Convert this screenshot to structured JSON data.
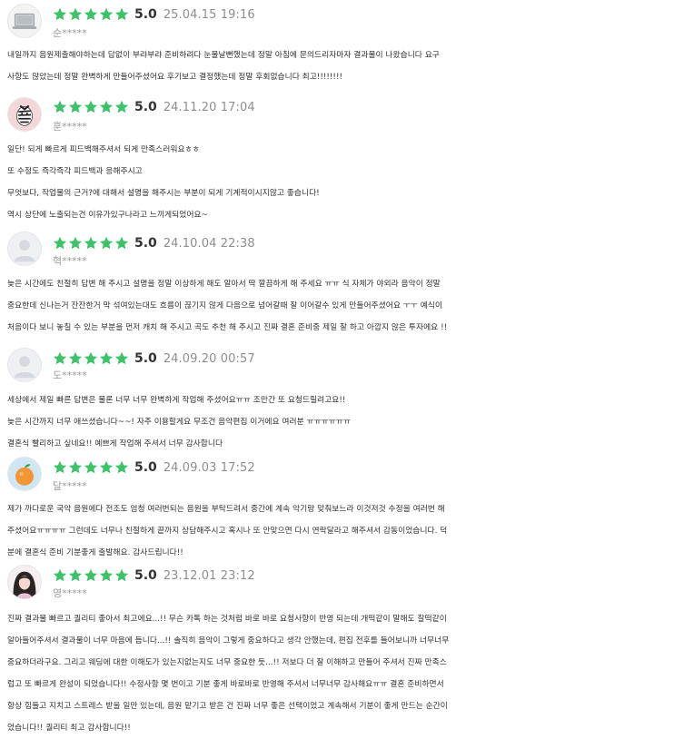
{
  "colors": {
    "star": "#3dc26a",
    "text": "#303030",
    "muted": "#8e8e8e"
  },
  "reviews": [
    {
      "avatar": "laptop-avatar",
      "score": "5.0",
      "date": "25.04.15 19:16",
      "user": "순*****",
      "lines": [
        "내일까지 음원제출해야하는데 답없이 부랴부랴 준비하려다 눈물날뻔했는데 정말 아침에 문의드리자마자 결과물이 나왔습니다 요구",
        "사항도 많았는데 정말  완벽하게 만들어주셨어요 후기보고 결정했는데 정말 후회없습니다 최고!!!!!!!!"
      ]
    },
    {
      "avatar": "zebra-avatar",
      "score": "5.0",
      "date": "24.11.20 17:04",
      "user": "훈*****",
      "lines": [
        "일단! 되게 빠르게 피드백해주셔서 되게 만족스러워요ㅎㅎ",
        "또 수정도 즉각즉각 피드백과 응해주시고",
        "무엇보다, 작업물의 근거?에 대해서 설명을 해주시는 부분이 되게 기계적이시지않고 좋습니다!",
        "역시 상단에 노출되는건 이유가있구나라고 느끼게되었어요~"
      ]
    },
    {
      "avatar": "default-avatar",
      "score": "5.0",
      "date": "24.10.04 22:38",
      "user": "혁*****",
      "lines": [
        "늦은 시간에도 친절히 답변 해 주시고 설명을 정말 이상하게 해도 알아서 딱 깔끔하게 해 주세요 ㅠㅠ 식 자체가 야외라 음악이 정말",
        "중요한데 신나는거 잔잔한거 막 섞여있는대도 흐름이 끊기지 않게 다음으로 넘어갈때 잘 이어갈수 있게 만들어주셨어요 ㅜㅜ 예식이",
        "처음이다 보니 놓칠 수 있는 부분을 먼저 캐치 해 주시고 곡도 추천 해 주시고 진짜 결혼 준비중 제일 잘 하고 아깝지 않은 투자에요 !!"
      ]
    },
    {
      "avatar": "default-avatar",
      "score": "5.0",
      "date": "24.09.20 00:57",
      "user": "도*****",
      "lines": [
        "세상에서 제일 빠른 답변은 물론 너무 너무 완벽하게 작업해 주셨어요ㅠㅠ 조만간 또 요청드릴려고요!!",
        "늦은 시간까지 너무 애쓰셨습니다~~! 자주 이용할게요 무조건 음악편집 이거에요 여러분 ㅠㅠㅠㅠㅠㅠ",
        "결혼식 빨리하고 싶네요!! 예쁘게 작업해 주셔서 너무 감사합니다"
      ]
    },
    {
      "avatar": "orange-avatar",
      "score": "5.0",
      "date": "24.09.03 17:52",
      "user": "달*****",
      "lines": [
        "제가 까다로운 국악 음원에다 전조도 엄청 여러번되는 음원을 부탁드려서 중간에 계속 악기랑 맞춰보느라 이것저것 수정을 여러번 해",
        "주셨어요ㅠㅠㅠㅠ 그런데도 너무나 친절하게 끝까지 상담해주시고 혹시나 또 안맞으면 다시 연락달라고 해주셔서 감동이었습니다. 덕",
        "분에 결혼식 준비 기분좋게 출발해요. 감사드립니다!!"
      ]
    },
    {
      "avatar": "portrait-avatar",
      "score": "5.0",
      "date": "23.12.01 23:12",
      "user": "영*****",
      "lines": [
        "진짜 결과물 빠르고 퀄리티 좋아서 최고에요...!! 무슨 카톡 하는 것처럼 바로 바로 요청사항이 반영 되는데 개떡같이 말해도 찰떡같이",
        "알아들어주셔서 결과물이 너무 마음에 듭니다...!! 솔직히 음악이 그렇게 중요하다고 생각 안했는데, 편집 전후를 들어보니까 너무너무",
        "중요하더라구요. 그리고 웨딩에 대한 이해도가 있는지없는지도 너무 중요한 듯...!! 저보다 더 잘 이해하고 만들어 주셔서 진짜 만족스",
        "럽고 또 빠르게 완성이 되었습니다!! 수정사항 몇 번이고 기분 좋게 바로바로 반영해 주셔서 너무너무 감사해요ㅠㅠ 결혼 준비하면서",
        "항상 힘들고 지치고 스트레스 받을 일만 있는데, 음원 맡기고 받은 건 진짜 너무 좋은 선택이었고 계속해서 기분이 좋게 만드는 순간이",
        "었습니다!! 퀄리티 최고 감사합니다!!"
      ]
    }
  ]
}
